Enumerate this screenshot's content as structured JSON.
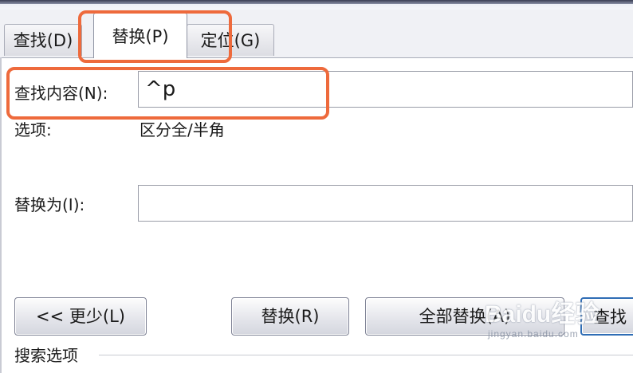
{
  "tabs": {
    "find": "查找(D)",
    "replace": "替换(P)",
    "goto": "定位(G)"
  },
  "find": {
    "label": "查找内容(N):",
    "value": "^p"
  },
  "options": {
    "label": "选项:",
    "value": "区分全/半角"
  },
  "replace": {
    "label": "替换为(I):",
    "value": ""
  },
  "buttons": {
    "less": "<< 更少(L)",
    "replace": "替换(R)",
    "replace_all": "全部替换(A)",
    "find_next": "查找"
  },
  "search_options": {
    "label": "搜索选项"
  },
  "watermark": {
    "main": "Baidu经验",
    "sub": "jingyan.baidu.com"
  },
  "colors": {
    "highlight": "#ee6a3c",
    "focus_border": "#2f6db5"
  }
}
